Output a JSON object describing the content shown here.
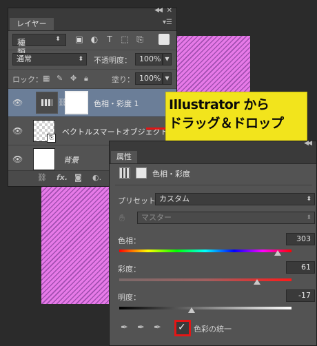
{
  "layers_panel": {
    "tab_label": "レイヤー",
    "filter": {
      "value": "種類"
    },
    "blend": {
      "mode": "通常",
      "opacity_label": "不透明度：",
      "opacity": "100%"
    },
    "lock": {
      "label": "ロック：",
      "fill_label": "塗り：",
      "fill": "100%"
    },
    "layers": [
      {
        "name": "色相・彩度 1",
        "selected": true
      },
      {
        "name": "ベクトルスマートオブジェクト",
        "selected": false
      },
      {
        "name": "背景",
        "selected": false
      }
    ]
  },
  "callout": {
    "line1": "Illustrator から",
    "line2": "ドラッグ＆ドロップ",
    "color": "#f2e41c",
    "arrow_color": "#e31616"
  },
  "properties_panel": {
    "tab_label": "属性",
    "title": "色相・彩度",
    "preset_label": "プリセット：",
    "preset_value": "カスタム",
    "channel_value": "マスター",
    "hue": {
      "label": "色相：",
      "value": "303",
      "fraction": 0.92
    },
    "saturation": {
      "label": "彩度：",
      "value": "61",
      "fraction": 0.8
    },
    "lightness": {
      "label": "明度：",
      "value": "-17",
      "fraction": 0.42
    },
    "colorize": {
      "label": "色彩の統一",
      "checked": true,
      "highlight": "#e31616"
    }
  }
}
